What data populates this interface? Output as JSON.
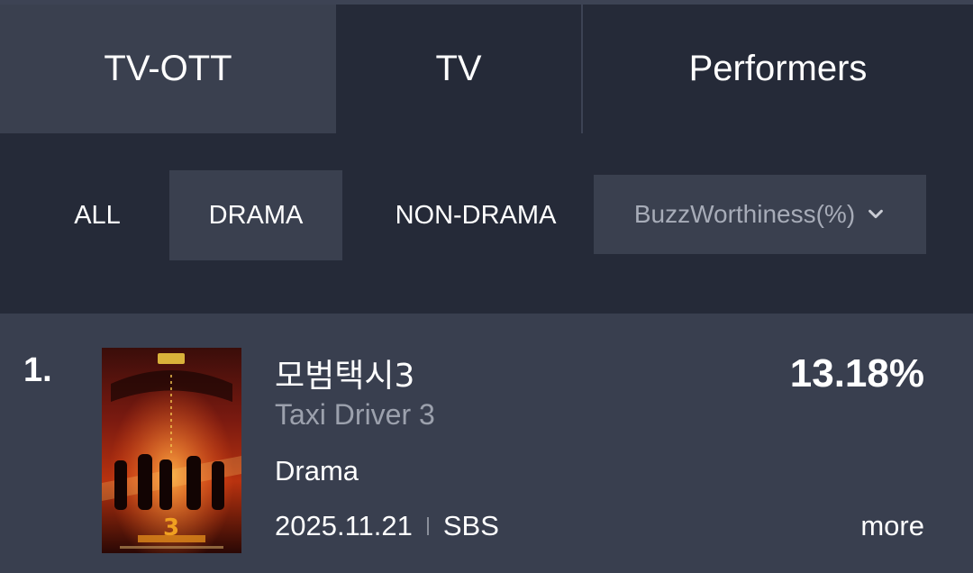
{
  "tabs": [
    {
      "label": "TV-OTT",
      "active": true
    },
    {
      "label": "TV",
      "active": false
    },
    {
      "label": "Performers",
      "active": false
    }
  ],
  "filters": {
    "chips": [
      {
        "label": "ALL",
        "active": false
      },
      {
        "label": "DRAMA",
        "active": true
      },
      {
        "label": "NON-DRAMA",
        "active": false
      }
    ],
    "metric_select": {
      "value": "BuzzWorthiness(%)",
      "icon": "chevron-down-icon"
    }
  },
  "ranking": [
    {
      "rank": "1.",
      "title_kr": "모범택시3",
      "title_en": "Taxi Driver 3",
      "genre": "Drama",
      "date": "2025.11.21",
      "network": "SBS",
      "score": "13.18%",
      "more_label": "more",
      "poster_overlay": "3"
    }
  ],
  "colors": {
    "background": "#1f2330",
    "panel": "#252a38",
    "active": "#3a404f",
    "item": "#393f4f",
    "muted_text": "#9ca1ad"
  }
}
